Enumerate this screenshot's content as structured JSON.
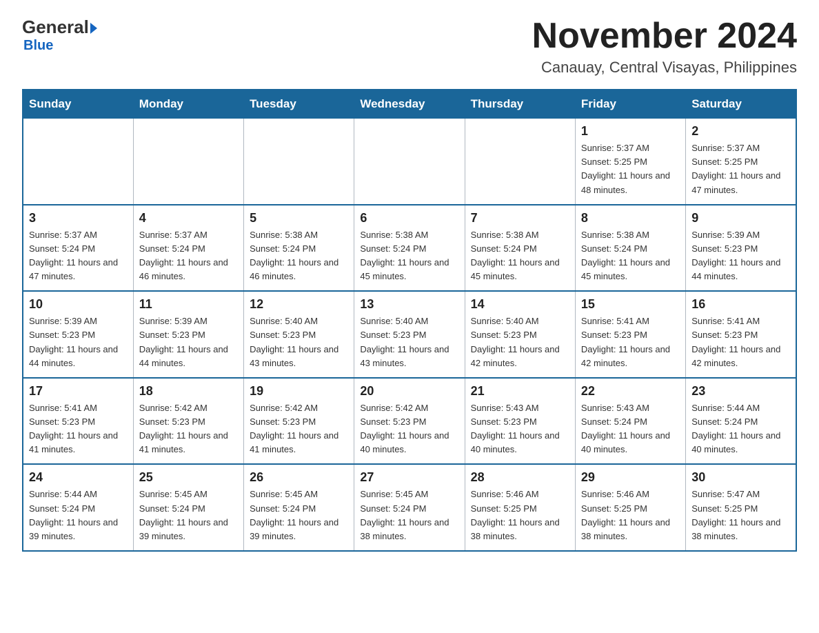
{
  "header": {
    "logo_general": "General",
    "logo_blue": "Blue",
    "month_title": "November 2024",
    "location": "Canauay, Central Visayas, Philippines"
  },
  "weekdays": [
    "Sunday",
    "Monday",
    "Tuesday",
    "Wednesday",
    "Thursday",
    "Friday",
    "Saturday"
  ],
  "weeks": [
    [
      {
        "day": "",
        "sunrise": "",
        "sunset": "",
        "daylight": ""
      },
      {
        "day": "",
        "sunrise": "",
        "sunset": "",
        "daylight": ""
      },
      {
        "day": "",
        "sunrise": "",
        "sunset": "",
        "daylight": ""
      },
      {
        "day": "",
        "sunrise": "",
        "sunset": "",
        "daylight": ""
      },
      {
        "day": "",
        "sunrise": "",
        "sunset": "",
        "daylight": ""
      },
      {
        "day": "1",
        "sunrise": "Sunrise: 5:37 AM",
        "sunset": "Sunset: 5:25 PM",
        "daylight": "Daylight: 11 hours and 48 minutes."
      },
      {
        "day": "2",
        "sunrise": "Sunrise: 5:37 AM",
        "sunset": "Sunset: 5:25 PM",
        "daylight": "Daylight: 11 hours and 47 minutes."
      }
    ],
    [
      {
        "day": "3",
        "sunrise": "Sunrise: 5:37 AM",
        "sunset": "Sunset: 5:24 PM",
        "daylight": "Daylight: 11 hours and 47 minutes."
      },
      {
        "day": "4",
        "sunrise": "Sunrise: 5:37 AM",
        "sunset": "Sunset: 5:24 PM",
        "daylight": "Daylight: 11 hours and 46 minutes."
      },
      {
        "day": "5",
        "sunrise": "Sunrise: 5:38 AM",
        "sunset": "Sunset: 5:24 PM",
        "daylight": "Daylight: 11 hours and 46 minutes."
      },
      {
        "day": "6",
        "sunrise": "Sunrise: 5:38 AM",
        "sunset": "Sunset: 5:24 PM",
        "daylight": "Daylight: 11 hours and 45 minutes."
      },
      {
        "day": "7",
        "sunrise": "Sunrise: 5:38 AM",
        "sunset": "Sunset: 5:24 PM",
        "daylight": "Daylight: 11 hours and 45 minutes."
      },
      {
        "day": "8",
        "sunrise": "Sunrise: 5:38 AM",
        "sunset": "Sunset: 5:24 PM",
        "daylight": "Daylight: 11 hours and 45 minutes."
      },
      {
        "day": "9",
        "sunrise": "Sunrise: 5:39 AM",
        "sunset": "Sunset: 5:23 PM",
        "daylight": "Daylight: 11 hours and 44 minutes."
      }
    ],
    [
      {
        "day": "10",
        "sunrise": "Sunrise: 5:39 AM",
        "sunset": "Sunset: 5:23 PM",
        "daylight": "Daylight: 11 hours and 44 minutes."
      },
      {
        "day": "11",
        "sunrise": "Sunrise: 5:39 AM",
        "sunset": "Sunset: 5:23 PM",
        "daylight": "Daylight: 11 hours and 44 minutes."
      },
      {
        "day": "12",
        "sunrise": "Sunrise: 5:40 AM",
        "sunset": "Sunset: 5:23 PM",
        "daylight": "Daylight: 11 hours and 43 minutes."
      },
      {
        "day": "13",
        "sunrise": "Sunrise: 5:40 AM",
        "sunset": "Sunset: 5:23 PM",
        "daylight": "Daylight: 11 hours and 43 minutes."
      },
      {
        "day": "14",
        "sunrise": "Sunrise: 5:40 AM",
        "sunset": "Sunset: 5:23 PM",
        "daylight": "Daylight: 11 hours and 42 minutes."
      },
      {
        "day": "15",
        "sunrise": "Sunrise: 5:41 AM",
        "sunset": "Sunset: 5:23 PM",
        "daylight": "Daylight: 11 hours and 42 minutes."
      },
      {
        "day": "16",
        "sunrise": "Sunrise: 5:41 AM",
        "sunset": "Sunset: 5:23 PM",
        "daylight": "Daylight: 11 hours and 42 minutes."
      }
    ],
    [
      {
        "day": "17",
        "sunrise": "Sunrise: 5:41 AM",
        "sunset": "Sunset: 5:23 PM",
        "daylight": "Daylight: 11 hours and 41 minutes."
      },
      {
        "day": "18",
        "sunrise": "Sunrise: 5:42 AM",
        "sunset": "Sunset: 5:23 PM",
        "daylight": "Daylight: 11 hours and 41 minutes."
      },
      {
        "day": "19",
        "sunrise": "Sunrise: 5:42 AM",
        "sunset": "Sunset: 5:23 PM",
        "daylight": "Daylight: 11 hours and 41 minutes."
      },
      {
        "day": "20",
        "sunrise": "Sunrise: 5:42 AM",
        "sunset": "Sunset: 5:23 PM",
        "daylight": "Daylight: 11 hours and 40 minutes."
      },
      {
        "day": "21",
        "sunrise": "Sunrise: 5:43 AM",
        "sunset": "Sunset: 5:23 PM",
        "daylight": "Daylight: 11 hours and 40 minutes."
      },
      {
        "day": "22",
        "sunrise": "Sunrise: 5:43 AM",
        "sunset": "Sunset: 5:24 PM",
        "daylight": "Daylight: 11 hours and 40 minutes."
      },
      {
        "day": "23",
        "sunrise": "Sunrise: 5:44 AM",
        "sunset": "Sunset: 5:24 PM",
        "daylight": "Daylight: 11 hours and 40 minutes."
      }
    ],
    [
      {
        "day": "24",
        "sunrise": "Sunrise: 5:44 AM",
        "sunset": "Sunset: 5:24 PM",
        "daylight": "Daylight: 11 hours and 39 minutes."
      },
      {
        "day": "25",
        "sunrise": "Sunrise: 5:45 AM",
        "sunset": "Sunset: 5:24 PM",
        "daylight": "Daylight: 11 hours and 39 minutes."
      },
      {
        "day": "26",
        "sunrise": "Sunrise: 5:45 AM",
        "sunset": "Sunset: 5:24 PM",
        "daylight": "Daylight: 11 hours and 39 minutes."
      },
      {
        "day": "27",
        "sunrise": "Sunrise: 5:45 AM",
        "sunset": "Sunset: 5:24 PM",
        "daylight": "Daylight: 11 hours and 38 minutes."
      },
      {
        "day": "28",
        "sunrise": "Sunrise: 5:46 AM",
        "sunset": "Sunset: 5:25 PM",
        "daylight": "Daylight: 11 hours and 38 minutes."
      },
      {
        "day": "29",
        "sunrise": "Sunrise: 5:46 AM",
        "sunset": "Sunset: 5:25 PM",
        "daylight": "Daylight: 11 hours and 38 minutes."
      },
      {
        "day": "30",
        "sunrise": "Sunrise: 5:47 AM",
        "sunset": "Sunset: 5:25 PM",
        "daylight": "Daylight: 11 hours and 38 minutes."
      }
    ]
  ]
}
